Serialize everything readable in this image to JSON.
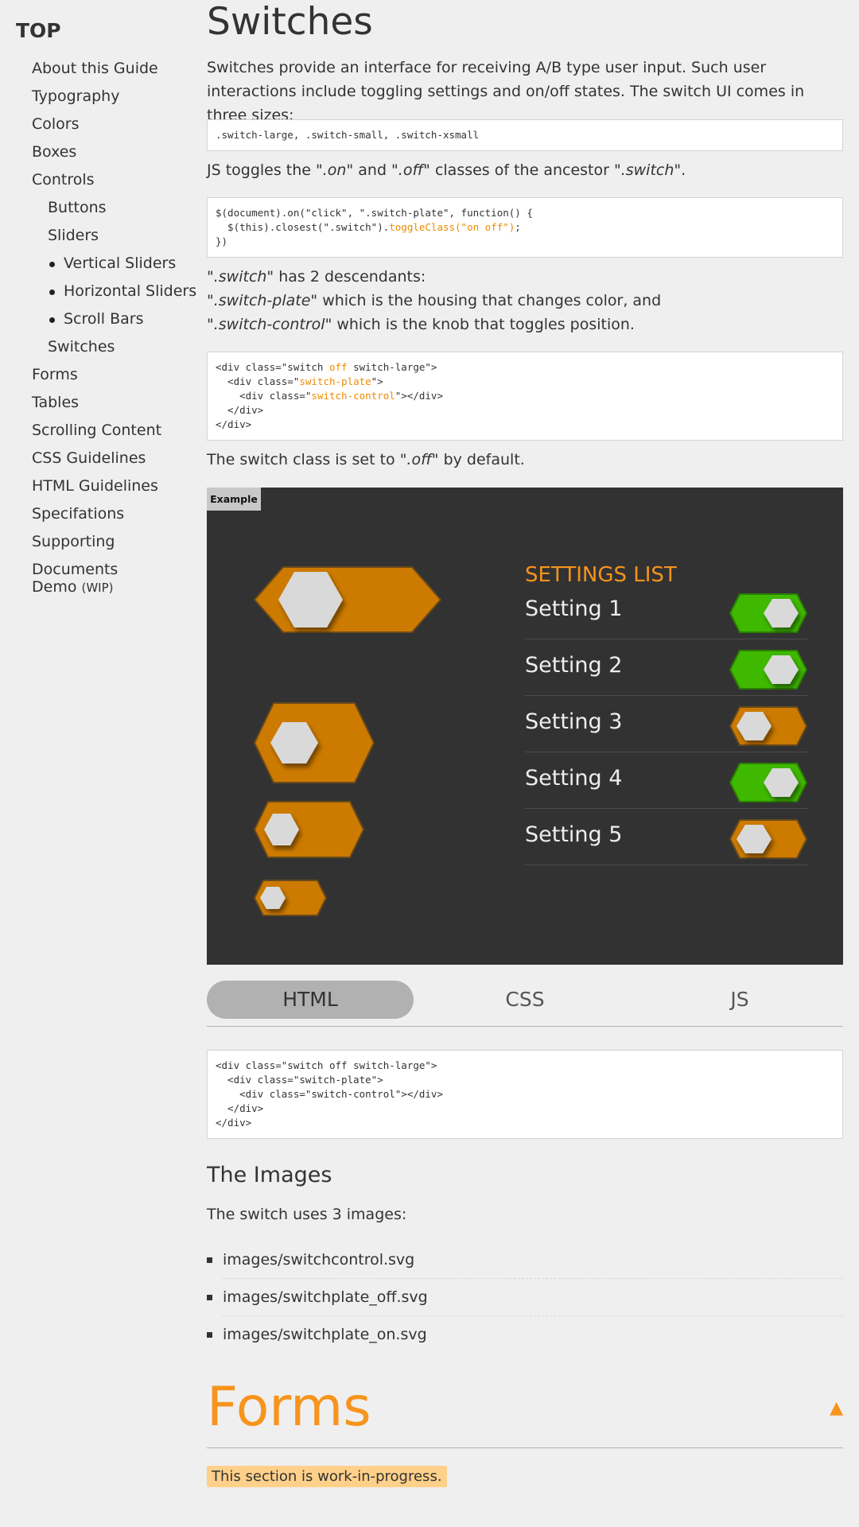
{
  "sidebar": {
    "top_label": "TOP",
    "items": [
      {
        "label": "About this Guide",
        "level": 1
      },
      {
        "label": "Typography",
        "level": 1
      },
      {
        "label": "Colors",
        "level": 1
      },
      {
        "label": "Boxes",
        "level": 1
      },
      {
        "label": "Controls",
        "level": 1
      },
      {
        "label": "Buttons",
        "level": 2
      },
      {
        "label": "Sliders",
        "level": 2
      },
      {
        "label": "Vertical Sliders",
        "level": 3
      },
      {
        "label": "Horizontal Sliders",
        "level": 3
      },
      {
        "label": "Scroll Bars",
        "level": 3
      },
      {
        "label": "Switches",
        "level": 2
      },
      {
        "label": "Forms",
        "level": 1
      },
      {
        "label": "Tables",
        "level": 1
      },
      {
        "label": "Scrolling Content",
        "level": 1
      },
      {
        "label": "CSS Guidelines",
        "level": 1
      },
      {
        "label": "HTML Guidelines",
        "level": 1
      },
      {
        "label": "Specifations",
        "level": 1
      },
      {
        "label": "Supporting Documents",
        "level": 1
      }
    ],
    "demo_label": "Demo",
    "demo_suffix": "(WIP)"
  },
  "switches": {
    "title": "Switches",
    "intro": "Switches provide an interface for receiving A/B type user input. Such user interactions include toggling settings and on/off states. The switch UI comes in three sizes:",
    "sizes_code": ".switch-large, .switch-small, .switch-xsmall",
    "js_text_1": "JS toggles the ",
    "js_on": "\".on\"",
    "js_and": " and ",
    "js_off": "\".off\"",
    "js_text_2": " classes of the ancestor ",
    "js_switch": "\".switch\"",
    "js_end": ".",
    "js_code_1": "$(document).on(\"click\", \".switch-plate\", function() {\n  $(this).closest(\".switch\").",
    "js_code_hl": "toggleClass(\"on off\")",
    "js_code_2": ";\n})",
    "desc_switch": "\".switch\"",
    "desc_line1": " has 2 descendants:",
    "desc_plate": "\".switch-plate\"",
    "desc_line2": " which is the housing that changes color, and",
    "desc_control": "\".switch-control\"",
    "desc_line3": " which is the knob that toggles position.",
    "html_code_a": "<div class=\"switch ",
    "html_code_off": "off",
    "html_code_b": " switch-large\">\n  <div class=\"",
    "html_code_plate": "switch-plate",
    "html_code_c": "\">\n    <div class=\"",
    "html_code_control": "switch-control",
    "html_code_d": "\"></div>\n  </div>\n</div>",
    "default_text_1": "The switch class is set to ",
    "default_off": "\".off\"",
    "default_text_2": " by default."
  },
  "example": {
    "badge": "Example",
    "settings_title": "SETTINGS LIST",
    "settings": [
      {
        "label": "Setting 1",
        "state": "on"
      },
      {
        "label": "Setting 2",
        "state": "on"
      },
      {
        "label": "Setting 3",
        "state": "off"
      },
      {
        "label": "Setting 4",
        "state": "on"
      },
      {
        "label": "Setting 5",
        "state": "off"
      }
    ],
    "colors": {
      "off": "#cc7a00",
      "on": "#3fb800",
      "knob": "#d9d9d9",
      "bg": "#323232"
    }
  },
  "tabs": [
    "HTML",
    "CSS",
    "JS"
  ],
  "tab_code": "<div class=\"switch off switch-large\">\n  <div class=\"switch-plate\">\n    <div class=\"switch-control\"></div>\n  </div>\n</div>",
  "images": {
    "title": "The Images",
    "intro": "The switch uses 3 images:",
    "files": [
      "images/switchcontrol.svg",
      "images/switchplate_off.svg",
      "images/switchplate_on.svg"
    ]
  },
  "forms": {
    "title": "Forms",
    "arrow": "▲",
    "wip": "This section is work-in-progress."
  }
}
